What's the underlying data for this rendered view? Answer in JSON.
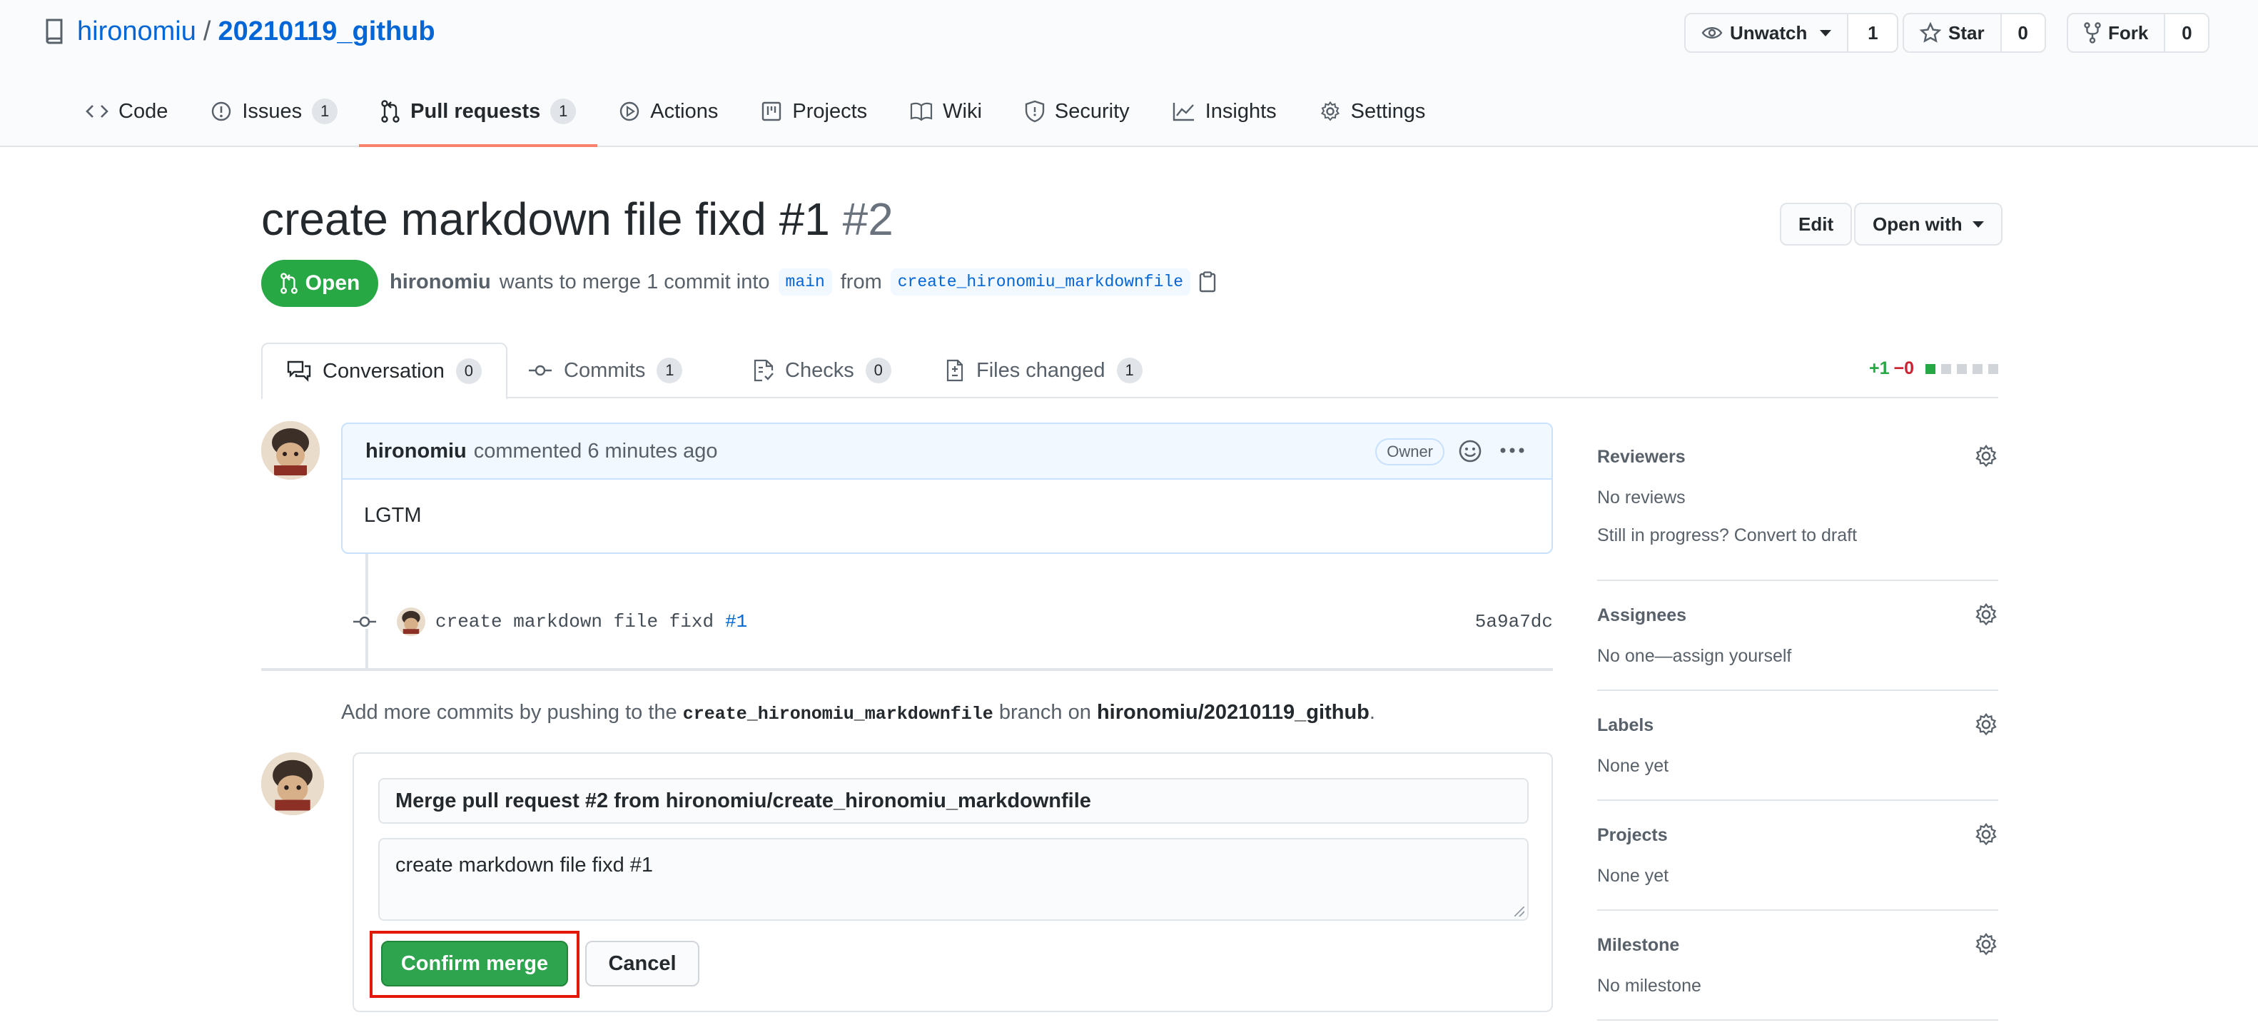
{
  "repo": {
    "owner": "hironomiu",
    "separator": "/",
    "name": "20210119_github"
  },
  "header_buttons": {
    "unwatch": {
      "label": "Unwatch",
      "count": "1"
    },
    "star": {
      "label": "Star",
      "count": "0"
    },
    "fork": {
      "label": "Fork",
      "count": "0"
    }
  },
  "repo_tabs": [
    {
      "label": "Code"
    },
    {
      "label": "Issues",
      "count": "1"
    },
    {
      "label": "Pull requests",
      "count": "1"
    },
    {
      "label": "Actions"
    },
    {
      "label": "Projects"
    },
    {
      "label": "Wiki"
    },
    {
      "label": "Security"
    },
    {
      "label": "Insights"
    },
    {
      "label": "Settings"
    }
  ],
  "pr": {
    "title": "create markdown file fixd #1",
    "number": "#2",
    "edit_label": "Edit",
    "open_with_label": "Open with",
    "status": "Open",
    "author": "hironomiu",
    "merge_text": "wants to merge 1 commit into",
    "base_branch": "main",
    "from_text": "from",
    "head_branch": "create_hironomiu_markdownfile"
  },
  "pr_tabs": [
    {
      "label": "Conversation",
      "count": "0"
    },
    {
      "label": "Commits",
      "count": "1"
    },
    {
      "label": "Checks",
      "count": "0"
    },
    {
      "label": "Files changed",
      "count": "1"
    }
  ],
  "diffstat": {
    "additions": "+1",
    "deletions": "−0"
  },
  "comment": {
    "author": "hironomiu",
    "action": "commented 6 minutes ago",
    "role": "Owner",
    "body": "LGTM"
  },
  "commit": {
    "message": "create markdown file fixd",
    "ref": "#1",
    "sha": "5a9a7dc"
  },
  "push_tip": {
    "prefix": "Add more commits by pushing to the",
    "branch": "create_hironomiu_markdownfile",
    "middle": "branch on",
    "repo": "hironomiu/20210119_github",
    "suffix": "."
  },
  "merge": {
    "title": "Merge pull request #2 from hironomiu/create_hironomiu_markdownfile",
    "body": "create markdown file fixd #1",
    "confirm_label": "Confirm merge",
    "cancel_label": "Cancel"
  },
  "sidebar": {
    "reviewers": {
      "heading": "Reviewers",
      "value": "No reviews",
      "extra": "Still in progress? Convert to draft"
    },
    "assignees": {
      "heading": "Assignees",
      "value": "No one—assign yourself"
    },
    "labels": {
      "heading": "Labels",
      "value": "None yet"
    },
    "projects": {
      "heading": "Projects",
      "value": "None yet"
    },
    "milestone": {
      "heading": "Milestone",
      "value": "No milestone"
    }
  },
  "colors": {
    "accent_blue": "#0366d6",
    "open_green": "#28a745",
    "merge_button_green": "#2ea44f",
    "tab_underline": "#f9826c",
    "highlight_red": "#e3170a"
  }
}
